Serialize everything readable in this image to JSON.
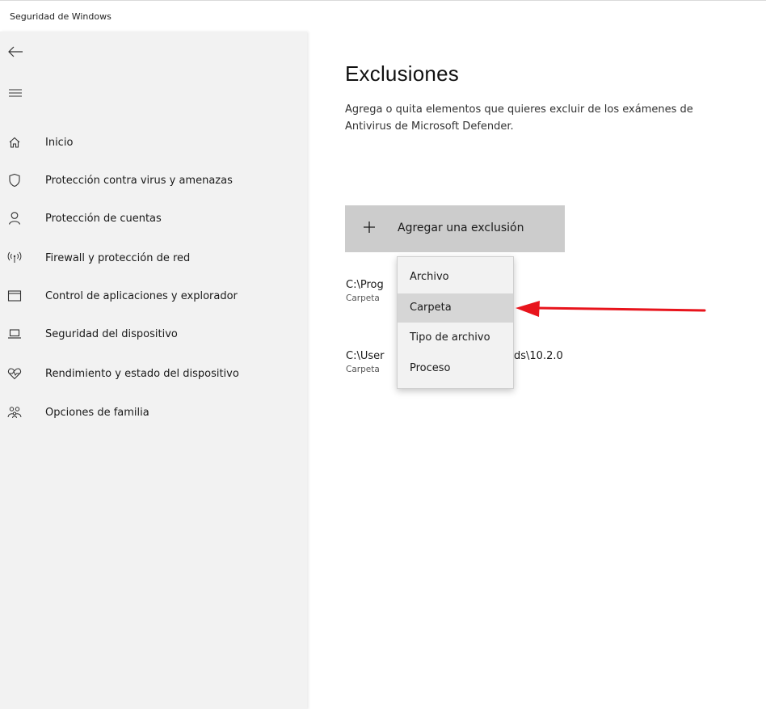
{
  "window": {
    "title": "Seguridad de Windows"
  },
  "sidebar": {
    "back_icon": "back-arrow-icon",
    "menu_icon": "hamburger-icon",
    "items": [
      {
        "label": "Inicio",
        "icon": "home-icon"
      },
      {
        "label": "Protección contra virus y amenazas",
        "icon": "shield-icon"
      },
      {
        "label": "Protección de cuentas",
        "icon": "person-icon"
      },
      {
        "label": "Firewall y protección de red",
        "icon": "antenna-icon"
      },
      {
        "label": "Control de aplicaciones y explorador",
        "icon": "browser-window-icon"
      },
      {
        "label": "Seguridad del dispositivo",
        "icon": "laptop-icon"
      },
      {
        "label": "Rendimiento y estado del dispositivo",
        "icon": "heart-icon"
      },
      {
        "label": "Opciones de familia",
        "icon": "family-icon"
      }
    ]
  },
  "main": {
    "title": "Exclusiones",
    "description_line1": "Agrega o quita elementos que quieres excluir de los exámenes de",
    "description_line2": "Antivirus de Microsoft Defender.",
    "add_button_label": "Agregar una exclusión",
    "exclusions": [
      {
        "path_visible_left": "C:\\Prog",
        "path_visible_right": "",
        "type": "Carpeta"
      },
      {
        "path_visible_left": "C:\\User",
        "path_visible_right": "ds\\10.2.0",
        "type": "Carpeta"
      }
    ]
  },
  "dropdown_menu": {
    "items": [
      "Archivo",
      "Carpeta",
      "Tipo de archivo",
      "Proceso"
    ],
    "highlighted": "Carpeta"
  },
  "colors": {
    "sidebar_bg": "#f2f2f2",
    "button_bg": "#cccccc",
    "menu_highlight": "#d6d6d6",
    "annotation_arrow": "#e8141c"
  }
}
